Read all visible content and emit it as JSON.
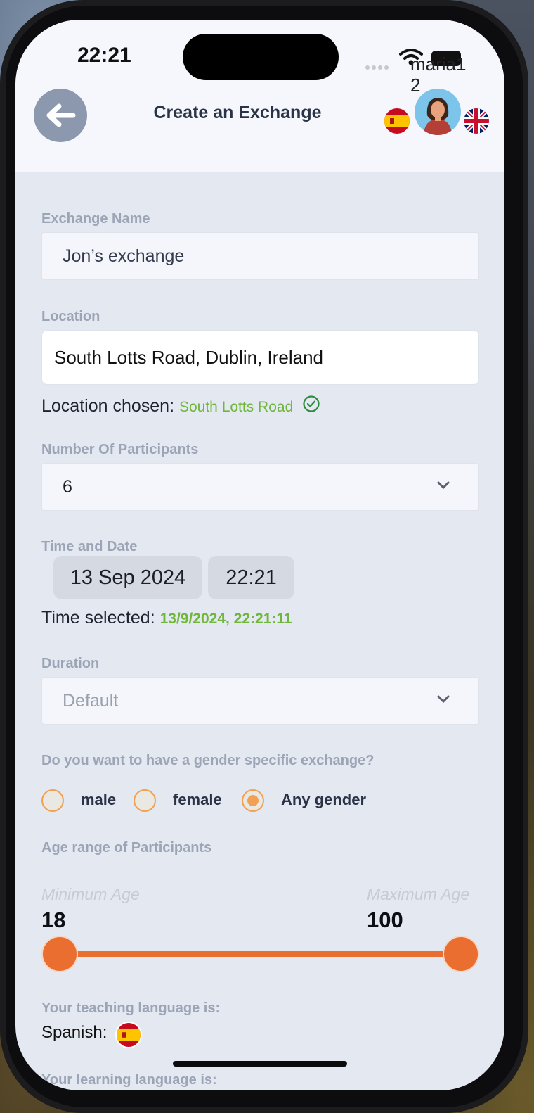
{
  "status_bar": {
    "time": "22:21"
  },
  "header": {
    "title": "Create an Exchange",
    "username": "maria1 2",
    "back_icon": "arrow-left-icon",
    "teaching_flag": "spain-flag-icon",
    "learning_flag": "uk-flag-icon"
  },
  "form": {
    "exchange_name": {
      "label": "Exchange Name",
      "value": "Jon’s exchange"
    },
    "location": {
      "label": "Location",
      "value": "South Lotts Road, Dublin, Ireland",
      "chosen_prefix": "Location chosen:",
      "chosen_value": "South Lotts Road"
    },
    "participants": {
      "label": "Number Of Participants",
      "value": "6"
    },
    "time_date": {
      "label": "Time and Date",
      "date": "13 Sep 2024",
      "time": "22:21",
      "selected_prefix": "Time selected:",
      "selected_value": "13/9/2024, 22:21:11"
    },
    "duration": {
      "label": "Duration",
      "placeholder": "Default"
    },
    "gender": {
      "label": "Do you want to have a gender specific exchange?",
      "options": [
        "male",
        "female",
        "Any gender"
      ],
      "selected": "Any gender"
    },
    "age": {
      "label": "Age range of Participants",
      "min_placeholder": "Minimum Age",
      "max_placeholder": "Maximum Age",
      "min": "18",
      "max": "100"
    },
    "teaching": {
      "label": "Your teaching language is:",
      "value": "Spanish:"
    },
    "learning": {
      "label": "Your learning language is:"
    }
  },
  "colors": {
    "accent": "#ea6e30",
    "success": "#6fb63a",
    "label": "#9ca5b6",
    "radio": "#f0a153"
  }
}
